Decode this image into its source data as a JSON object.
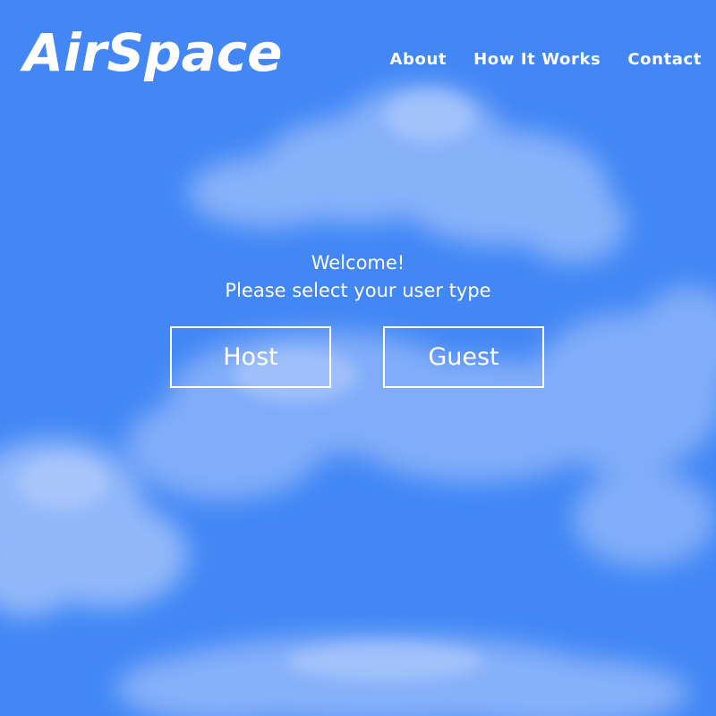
{
  "brand": {
    "logo_text": "AirSpace"
  },
  "nav": {
    "items": [
      {
        "label": "About"
      },
      {
        "label": "How It Works"
      },
      {
        "label": "Contact"
      }
    ]
  },
  "main": {
    "welcome_line1": "Welcome!",
    "welcome_line2": "Please select your user type",
    "buttons": {
      "host_label": "Host",
      "guest_label": "Guest"
    }
  },
  "colors": {
    "background": "#4287f5",
    "text": "#ffffff",
    "cloud": "#cfe0ff"
  }
}
